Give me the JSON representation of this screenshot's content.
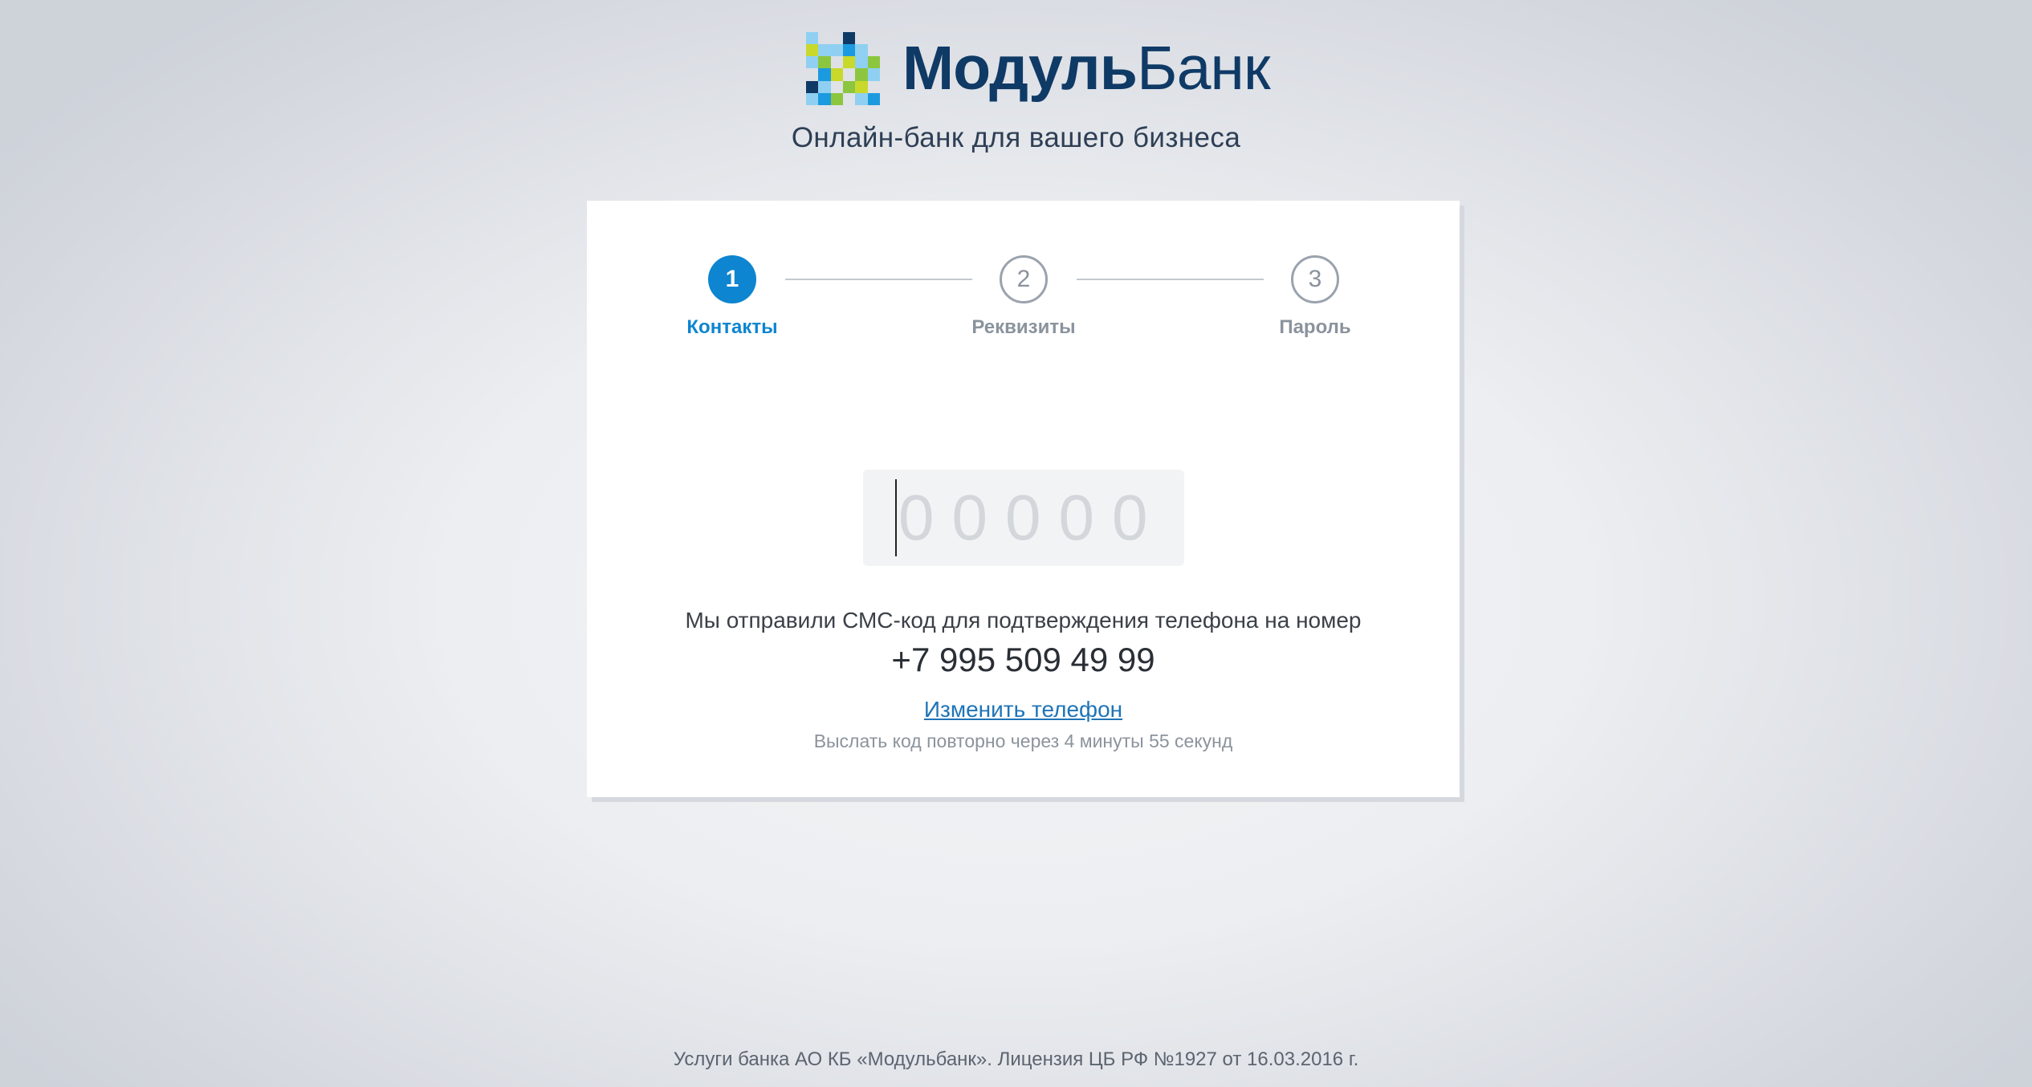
{
  "header": {
    "logo": {
      "name_bold": "Модуль",
      "name_light": "Банк",
      "mark_colors": {
        "dark_navy": "#0f3a66",
        "blue": "#1c9ae0",
        "light_blue": "#8fd0f2",
        "green": "#8cc63f",
        "yellow_green": "#c8d92b"
      }
    },
    "tagline": "Онлайн-банк для вашего бизнеса"
  },
  "stepper": {
    "steps": [
      {
        "number": "1",
        "label": "Контакты",
        "state": "active"
      },
      {
        "number": "2",
        "label": "Реквизиты",
        "state": "inactive"
      },
      {
        "number": "3",
        "label": "Пароль",
        "state": "inactive"
      }
    ],
    "active_color": "#0e85d0",
    "inactive_color": "#8a939d"
  },
  "sms": {
    "code_placeholder": "00000",
    "code_value": "",
    "sent_message": "Мы отправили СМС-код для подтверждения телефона на номер",
    "phone": "+7 995 509 49 99",
    "change_phone_label": "Изменить телефон",
    "resend_message": "Выслать код повторно через 4 минуты 55 секунд"
  },
  "footer": {
    "text": "Услуги банка АО КБ «Модульбанк». Лицензия ЦБ РФ №1927 от 16.03.2016 г."
  }
}
